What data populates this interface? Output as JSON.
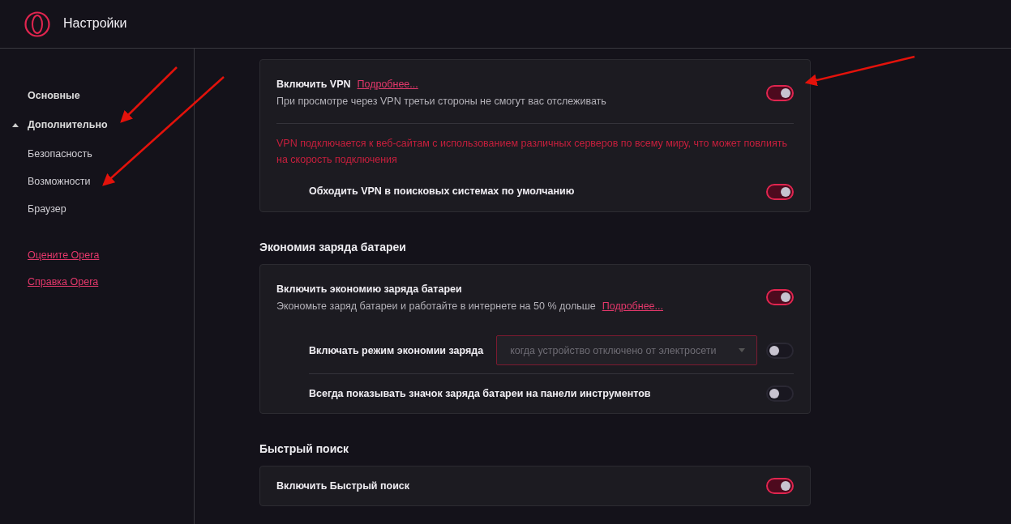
{
  "header": {
    "title": "Настройки"
  },
  "sidebar": {
    "items": [
      {
        "label": "Основные"
      },
      {
        "label": "Дополнительно",
        "expanded": true,
        "children": [
          {
            "label": "Безопасность"
          },
          {
            "label": "Возможности"
          },
          {
            "label": "Браузер"
          }
        ]
      }
    ],
    "links": [
      "Оцените Opera",
      "Справка Opera"
    ]
  },
  "sections": [
    {
      "rows": [
        {
          "kind": "toggle",
          "label": "Включить VPN",
          "link": "Подробнее...",
          "description": "При просмотре через VPN третьи стороны не смогут вас отслеживать",
          "on": true,
          "nested": false
        },
        {
          "kind": "divider"
        },
        {
          "kind": "notice",
          "text": "VPN подключается к веб-сайтам с использованием различных серверов по всему миру, что может повлиять на скорость подключения"
        },
        {
          "kind": "toggle",
          "label": "Обходить VPN в поисковых системах по умолчанию",
          "on": true,
          "nested": true
        }
      ]
    },
    {
      "heading": "Экономия заряда батареи",
      "rows": [
        {
          "kind": "toggle",
          "label": "Включить экономию заряда батареи",
          "description": "Экономьте заряд батареи и работайте в интернете на 50 % дольше",
          "link": "Подробнее...",
          "on": true,
          "nested": false
        },
        {
          "kind": "select-toggle",
          "label": "Включать режим экономии заряда",
          "value": "когда устройство отключено от электросети",
          "disabled": true,
          "on": false,
          "nested": true
        },
        {
          "kind": "divider",
          "nested": true
        },
        {
          "kind": "toggle",
          "label": "Всегда показывать значок заряда батареи на панели инструментов",
          "on": false,
          "nested": true
        }
      ]
    },
    {
      "heading": "Быстрый поиск",
      "rows": [
        {
          "kind": "toggle",
          "label": "Включить Быстрый поиск",
          "on": true,
          "nested": false
        }
      ]
    }
  ]
}
